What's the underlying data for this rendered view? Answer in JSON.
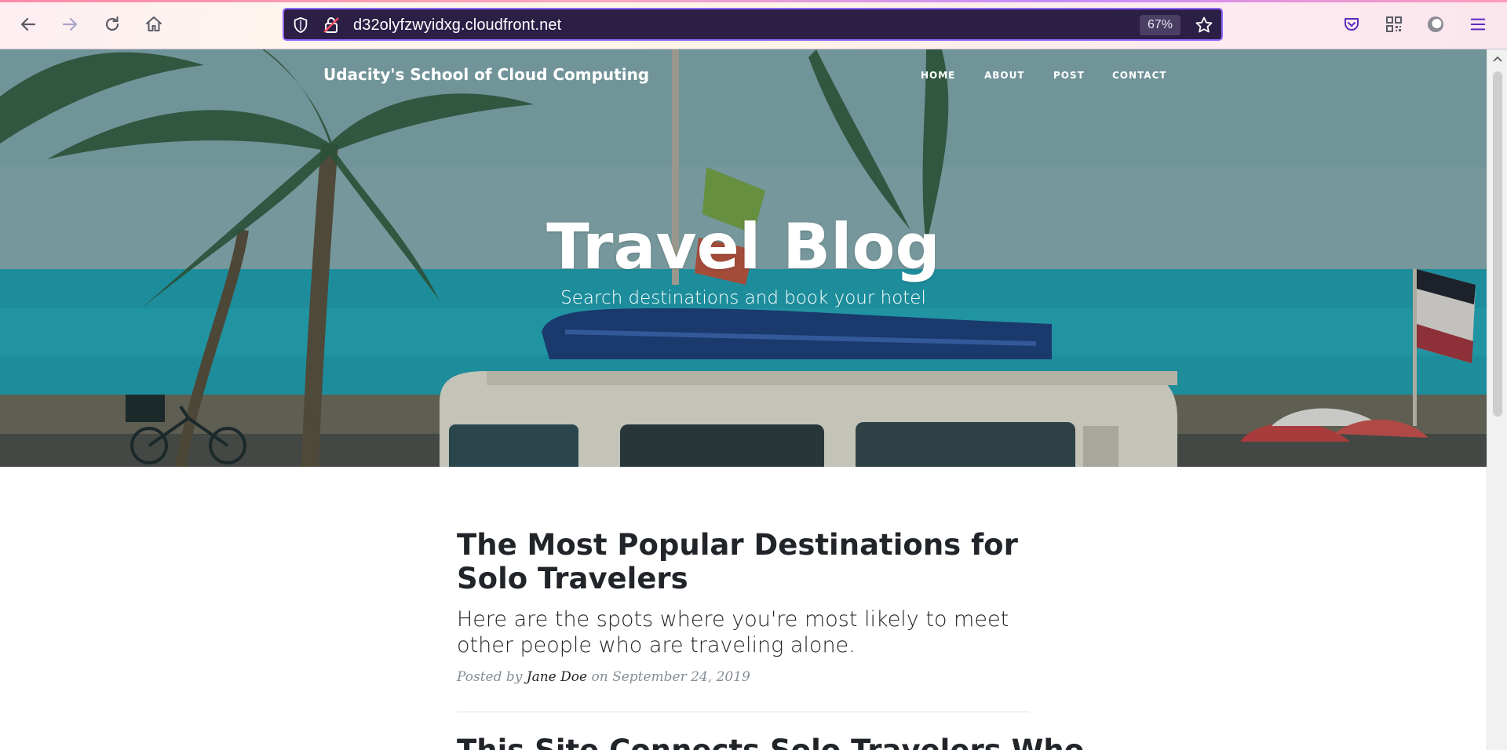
{
  "browser": {
    "url": "d32olyfzwyidxg.cloudfront.net",
    "zoom": "67%",
    "icons": [
      "back-arrow-icon",
      "forward-arrow-icon",
      "reload-icon",
      "home-icon",
      "shield-icon",
      "insecure-lock-icon",
      "star-icon",
      "pocket-icon",
      "qr-code-icon",
      "profile-icon",
      "hamburger-menu-icon"
    ]
  },
  "site": {
    "brand": "Udacity's School of Cloud Computing",
    "nav": [
      "HOME",
      "ABOUT",
      "POST",
      "CONTACT"
    ],
    "hero_title": "Travel Blog",
    "hero_subtitle": "Search destinations and book your hotel"
  },
  "posts": [
    {
      "title": "The Most Popular Destinations for Solo Travelers",
      "subtitle": "Here are the spots where you're most likely to meet other people who are traveling alone.",
      "meta_prefix": "Posted by",
      "author": "Jane Doe",
      "meta_on": "on",
      "date": "September 24, 2019"
    },
    {
      "title": "This Site Connects Solo Travelers Who"
    }
  ],
  "colors": {
    "urlbar_bg": "#2b1f46",
    "urlbar_border": "#8f67ff",
    "chrome_icon": "#5b5b66",
    "text_dark": "#212529",
    "meta_gray": "#868e96"
  }
}
